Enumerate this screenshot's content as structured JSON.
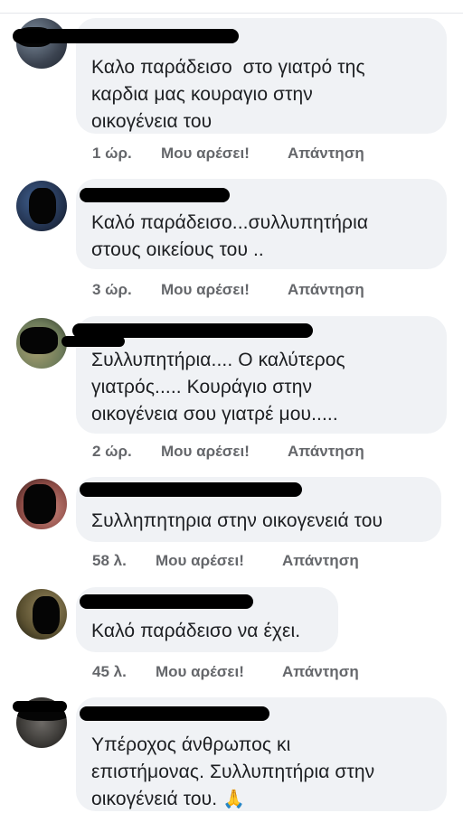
{
  "actions": {
    "like": "Μου αρέσει!",
    "reply": "Απάντηση"
  },
  "comments": [
    {
      "text": "Καλο παράδεισο  στο γιατρό της\nκαρδια μας κουραγιο στην\nοικογένεια του",
      "time": "1 ώρ."
    },
    {
      "text": "Καλό παράδεισο...συλλυπητήρια\nστους οικείους του ..",
      "time": "3 ώρ."
    },
    {
      "text": "Συλλυπητήρια.... Ο καλύτερος\nγιατρός..... Κουράγιο στην\nοικογένεια σου γιατρέ μου.....",
      "time": "2 ώρ."
    },
    {
      "text": "Συλληπητηρια στην οικογενειά του",
      "time": "58 λ."
    },
    {
      "text": "Καλό παράδεισο να έχει.",
      "time": "45 λ."
    },
    {
      "text": "Υπέροχος άνθρωπος κι\nεπιστήμονας. Συλλυπητήρια στην\nοικογένειά του.",
      "time": "",
      "emoji": "🙏"
    }
  ]
}
